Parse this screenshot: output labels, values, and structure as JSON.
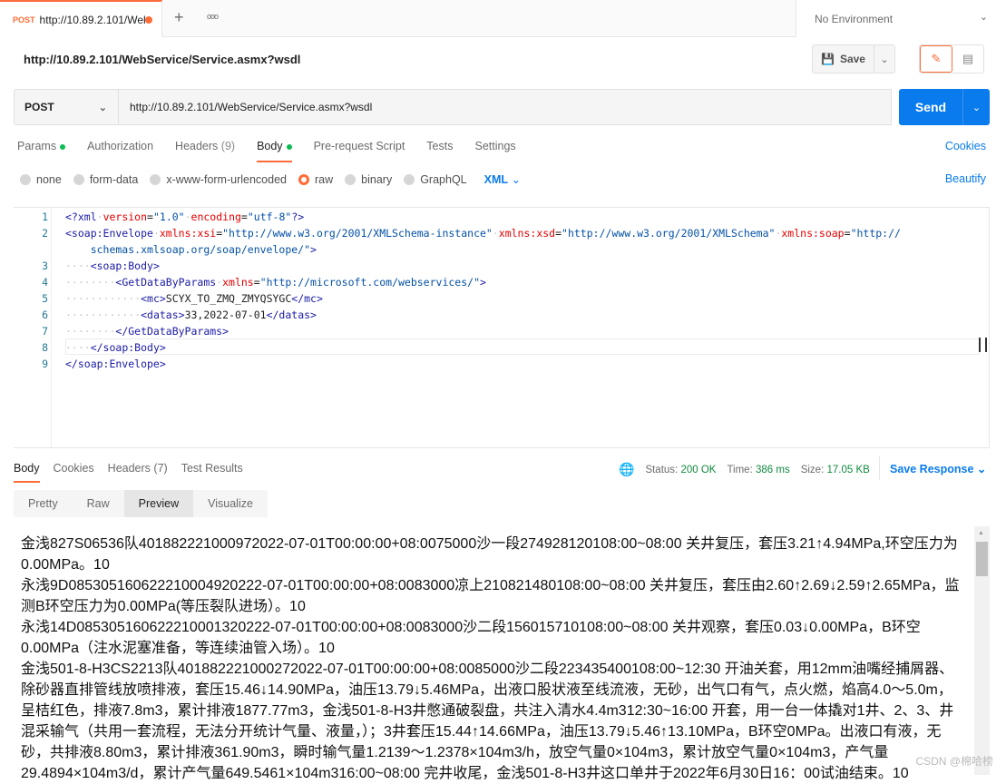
{
  "tab": {
    "method": "POST",
    "label": "http://10.89.2.101/Wel",
    "new": "+",
    "more": "ooo"
  },
  "environment": {
    "label": "No Environment"
  },
  "request": {
    "title": "http://10.89.2.101/WebService/Service.asmx?wsdl",
    "save": "Save",
    "method": "POST",
    "url": "http://10.89.2.101/WebService/Service.asmx?wsdl",
    "send": "Send"
  },
  "reqtabs": [
    {
      "label": "Params",
      "dot": true
    },
    {
      "label": "Authorization"
    },
    {
      "label": "Headers",
      "count": "(9)"
    },
    {
      "label": "Body",
      "dot": true,
      "active": true
    },
    {
      "label": "Pre-request Script"
    },
    {
      "label": "Tests"
    },
    {
      "label": "Settings"
    }
  ],
  "cookies": "Cookies",
  "bodytypes": [
    {
      "label": "none"
    },
    {
      "label": "form-data"
    },
    {
      "label": "x-www-form-urlencoded"
    },
    {
      "label": "raw",
      "selected": true
    },
    {
      "label": "binary"
    },
    {
      "label": "GraphQL"
    }
  ],
  "language": "XML",
  "beautify": "Beautify",
  "editor": {
    "lines": [
      {
        "n": "1",
        "seg": [
          [
            "t",
            "<?xml"
          ],
          [
            "w",
            "·"
          ],
          [
            "a",
            "version"
          ],
          [
            "x",
            "="
          ],
          [
            "v",
            "\"1.0\""
          ],
          [
            "w",
            "·"
          ],
          [
            "a",
            "encoding"
          ],
          [
            "x",
            "="
          ],
          [
            "v",
            "\"utf-8\""
          ],
          [
            "t",
            "?>"
          ]
        ]
      },
      {
        "n": "2",
        "seg": [
          [
            "t",
            "<soap:Envelope"
          ],
          [
            "w",
            "·"
          ],
          [
            "a",
            "xmlns:xsi"
          ],
          [
            "x",
            "="
          ],
          [
            "v",
            "\"http://www.w3.org/2001/XMLSchema-instance\""
          ],
          [
            "w",
            "·"
          ],
          [
            "a",
            "xmlns:xsd"
          ],
          [
            "x",
            "="
          ],
          [
            "v",
            "\"http://www.w3.org/2001/XMLSchema\""
          ],
          [
            "w",
            "·"
          ],
          [
            "a",
            "xmlns:soap"
          ],
          [
            "x",
            "="
          ],
          [
            "v",
            "\"http://"
          ]
        ]
      },
      {
        "n": "",
        "seg": [
          [
            "v",
            "    schemas.xmlsoap.org/soap/envelope/\""
          ],
          [
            "t",
            ">"
          ]
        ]
      },
      {
        "n": "3",
        "seg": [
          [
            "w",
            "····"
          ],
          [
            "t",
            "<soap:Body>"
          ]
        ]
      },
      {
        "n": "4",
        "seg": [
          [
            "w",
            "········"
          ],
          [
            "t",
            "<GetDataByParams"
          ],
          [
            "w",
            "·"
          ],
          [
            "a",
            "xmlns"
          ],
          [
            "x",
            "="
          ],
          [
            "v",
            "\"http://microsoft.com/webservices/\""
          ],
          [
            "t",
            ">"
          ]
        ]
      },
      {
        "n": "5",
        "seg": [
          [
            "w",
            "············"
          ],
          [
            "t",
            "<mc>"
          ],
          [
            "x",
            "SCYX_TO_ZMQ_ZMYQSYGC"
          ],
          [
            "t",
            "</mc>"
          ]
        ]
      },
      {
        "n": "6",
        "seg": [
          [
            "w",
            "············"
          ],
          [
            "t",
            "<datas>"
          ],
          [
            "x",
            "33,2022-07-01"
          ],
          [
            "t",
            "</datas>"
          ]
        ]
      },
      {
        "n": "7",
        "seg": [
          [
            "w",
            "········"
          ],
          [
            "t",
            "</GetDataByParams>"
          ]
        ]
      },
      {
        "n": "8",
        "seg": [
          [
            "w",
            "····"
          ],
          [
            "t",
            "</soap:Body>"
          ]
        ]
      },
      {
        "n": "9",
        "seg": [
          [
            "t",
            "</soap:Envelope>"
          ]
        ]
      }
    ]
  },
  "response": {
    "tabs": [
      {
        "label": "Body",
        "active": true
      },
      {
        "label": "Cookies"
      },
      {
        "label": "Headers",
        "count": "(7)"
      },
      {
        "label": "Test Results"
      }
    ],
    "status_label": "Status:",
    "status": "200 OK",
    "time_label": "Time:",
    "time": "386 ms",
    "size_label": "Size:",
    "size": "17.05 KB",
    "save": "Save Response",
    "views": [
      "Pretty",
      "Raw",
      "Preview",
      "Visualize"
    ],
    "active_view": "Preview",
    "preview": [
      "金浅827S06536队401882221000972022-07-01T00:00:00+08:0075000沙一段274928120108:00~08:00 关井复压，套压3.21↑4.94MPa,环空压力为0.00MPa。10",
      "永浅9D085305160622210004920222-07-01T00:00:00+08:0083000凉上210821480108:00~08:00 关井复压，套压由2.60↑2.69↓2.59↑2.65MPa，监测B环空压力为0.00MPa(等压裂队进场）。10",
      "永浅14D085305160622210001320222-07-01T00:00:00+08:0083000沙二段156015710108:00~08:00 关井观察，套压0.03↓0.00MPa，B环空0.00MPa（注水泥塞准备，等连续油管入场）。10",
      "金浅501-8-H3CS2213队401882221000272022-07-01T00:00:00+08:0085000沙二段223435400108:00~12:30 开油关套，用12mm油嘴经捕屑器、除砂器直排管线放喷排液，套压15.46↓14.90MPa，油压13.79↓5.46MPa，出液口股状液至线流液，无砂，出气口有气，点火燃，焰高4.0～5.0m，呈桔红色，排液7.8m3，累计排液1877.77m3，金浅501-8-H3井憋通破裂盘，共注入清水4.4m312:30~16:00 开套，用一台一体撬对1井、2、3、井混采输气（共用一套流程，无法分开统计气量、液量，）；3井套压15.44↑14.66MPa，油压13.79↓5.46↑13.10MPa，B环空0MPa。出液口有液，无砂，共排液8.80m3，累计排液361.90m3，瞬时输气量1.2139～1.2378×104m3/h，放空气量0×104m3，累计放空气量0×104m3，产气量29.4894×104m3/d，累计产气量649.5461×104m316:00~08:00 完井收尾，金浅501-8-H3井这口单井于2022年6月30日16：00试油结束。10"
    ]
  },
  "watermark": "CSDN @棉哈榜"
}
